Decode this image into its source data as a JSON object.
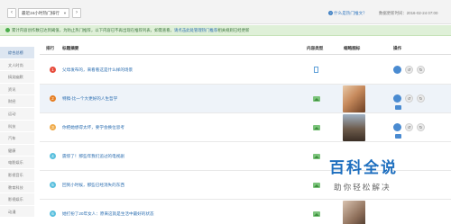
{
  "toolbar": {
    "prev_label": "‹",
    "next_label": "›",
    "period": "最近24小时热门排行",
    "help_link": "什么是热门推文？",
    "update_time": "数据更新时间：2016-02-24 07:00"
  },
  "notice": {
    "text": "累计内容创作数已达到阈值，为防止热门推荐，以下内容已不再出现在推荐列表，如需查看，",
    "link": "请点击此处管理热门推荐",
    "tail": "相关规则已经更新"
  },
  "sidebar": {
    "items": [
      {
        "label": "综合总榜",
        "active": true
      },
      {
        "label": "文人时尚",
        "active": false
      },
      {
        "label": "搞笑幽默",
        "active": false
      },
      {
        "label": "资讯",
        "active": false
      },
      {
        "label": "财经",
        "active": false
      },
      {
        "label": "运动",
        "active": false
      },
      {
        "label": "科技",
        "active": false
      },
      {
        "label": "汽车",
        "active": false
      },
      {
        "label": "健康",
        "active": false
      },
      {
        "label": "电影娱乐",
        "active": false
      },
      {
        "label": "影视音乐",
        "active": false
      },
      {
        "label": "教育科技",
        "active": false
      },
      {
        "label": "影视娱乐",
        "active": false
      },
      {
        "label": "动漫",
        "active": false
      }
    ]
  },
  "table": {
    "headers": {
      "rank": "排行",
      "title": "标题摘要",
      "type": "内容类型",
      "thumb": "缩略图标",
      "ops": "操作"
    },
    "rows": [
      {
        "rank": "1",
        "title": "父母发布的，来看看这是什么样的场景",
        "type": "doc",
        "rank_color": "#e74c3c",
        "thumb": "none"
      },
      {
        "rank": "2",
        "title": "特稿-比一个大更好的人生哲学",
        "type": "img",
        "rank_color": "#e67e22",
        "thumb": "portrait"
      },
      {
        "rank": "3",
        "title": "你把她想得太坏，要学会换位思考",
        "type": "img",
        "rank_color": "#f0ad4e",
        "thumb": "building"
      },
      {
        "rank": "4",
        "title": "震惊了！那些年我们追过的电视剧",
        "type": "img",
        "rank_color": "#5bc0de",
        "thumb": "none"
      },
      {
        "rank": "5",
        "title": "回到小时候，那些已经消失的东西",
        "type": "img",
        "rank_color": "#5bc0de",
        "thumb": "none"
      },
      {
        "rank": "6",
        "title": "她打扮了20年女人：原来这就是生活中最好的状态",
        "type": "img",
        "rank_color": "#5bc0de",
        "thumb": "portrait2"
      }
    ],
    "op_more": "…"
  },
  "watermark": {
    "title": "百科全说",
    "subtitle": "助你轻松解决"
  }
}
